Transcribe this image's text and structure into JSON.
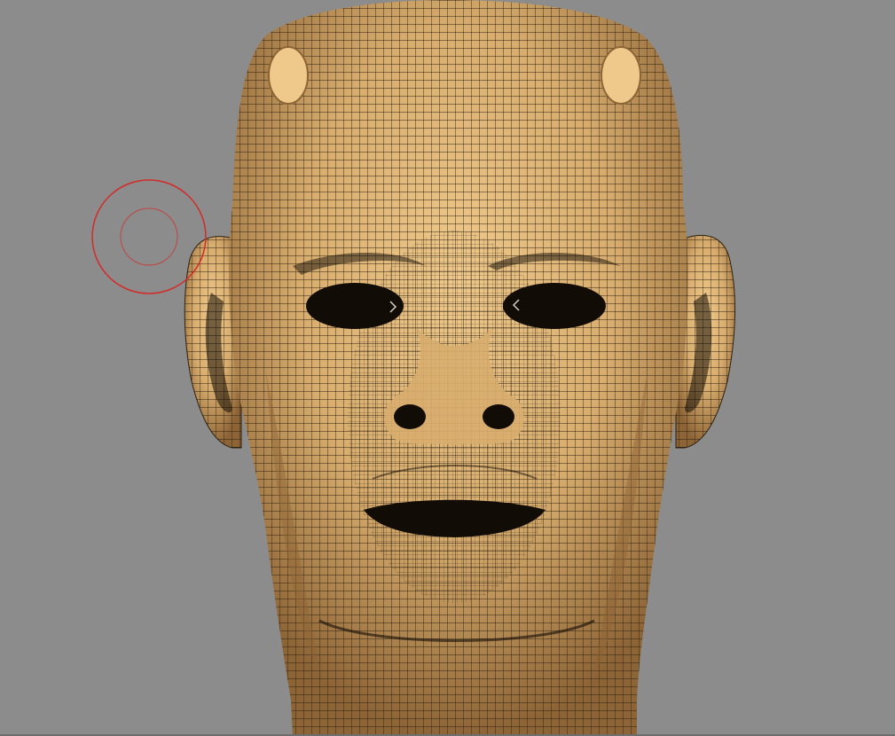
{
  "app": {
    "viewport": "3d-sculpt-viewport",
    "background_color": "#8c8c8c",
    "bottom_edge_color": "#6e6e6e"
  },
  "model": {
    "subject": "human-head-mesh",
    "display": "wireframe-over-matcap",
    "skin_color": "#d8ad6e",
    "skin_highlight": "#efc98b",
    "skin_shadow": "#8d6436",
    "wire_color": "#2d2112",
    "cavity_color": "#120c06"
  },
  "brush_cursor": {
    "icon": "brush-radius-icon",
    "color": "#d32a2a"
  }
}
